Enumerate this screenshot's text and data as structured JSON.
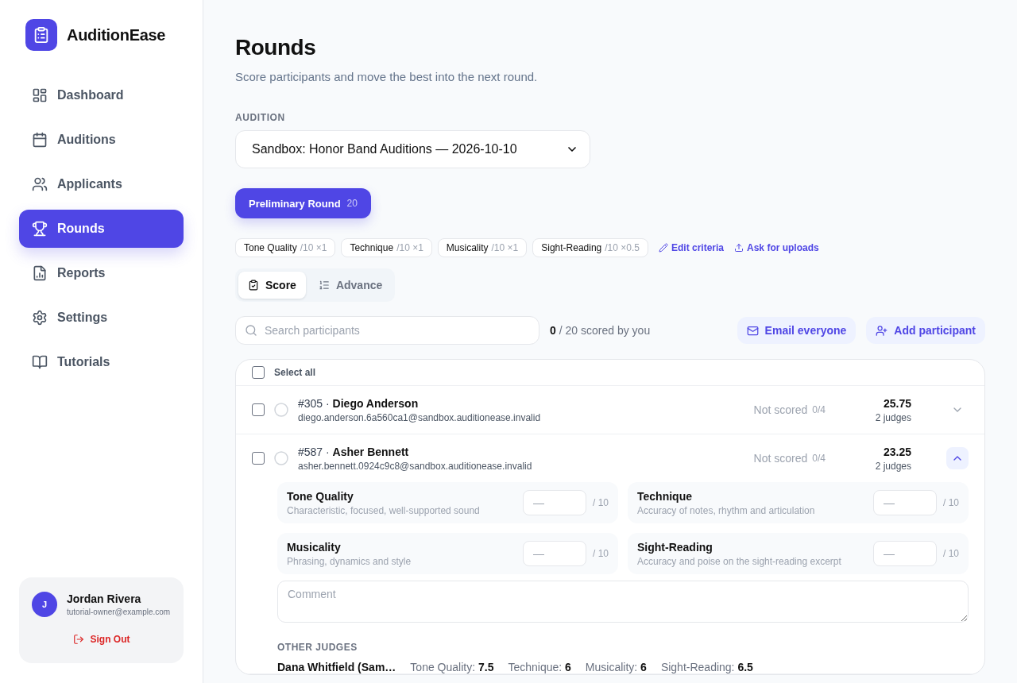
{
  "sidebar": {
    "brand": "AuditionEase",
    "nav": [
      {
        "label": "Dashboard",
        "selected": false
      },
      {
        "label": "Auditions",
        "selected": false
      },
      {
        "label": "Applicants",
        "selected": false
      },
      {
        "label": "Rounds",
        "selected": true
      },
      {
        "label": "Reports",
        "selected": false
      },
      {
        "label": "Settings",
        "selected": false
      },
      {
        "label": "Tutorials",
        "selected": false
      }
    ],
    "user": {
      "initial": "J",
      "name": "Jordan Rivera",
      "email": "tutorial-owner@example.com",
      "sign_out": "Sign Out"
    }
  },
  "header": {
    "title": "Rounds",
    "subtitle": "Score participants and move the best into the next round."
  },
  "audition": {
    "label": "AUDITION",
    "value": "Sandbox: Honor Band Auditions — 2026-10-10"
  },
  "rounds": [
    {
      "label": "Preliminary Round",
      "count": "20",
      "selected": true
    }
  ],
  "criteria": [
    {
      "name": "Tone Quality",
      "detail": "/10 ×1"
    },
    {
      "name": "Technique",
      "detail": "/10 ×1"
    },
    {
      "name": "Musicality",
      "detail": "/10 ×1"
    },
    {
      "name": "Sight-Reading",
      "detail": "/10 ×0.5"
    }
  ],
  "criteria_links": [
    {
      "label": "Edit criteria"
    },
    {
      "label": "Ask for uploads"
    }
  ],
  "tabs": [
    {
      "label": "Score",
      "selected": true
    },
    {
      "label": "Advance",
      "selected": false
    }
  ],
  "search": {
    "placeholder": "Search participants"
  },
  "progress": {
    "scored": "0",
    "label": "/ 20 scored by you"
  },
  "actions": [
    {
      "label": "Email everyone"
    },
    {
      "label": "Add participant"
    }
  ],
  "list": {
    "select_all": {
      "label": "Select all",
      "checked": false
    },
    "participants": [
      {
        "title": "#305 · **Diego Anderson**",
        "email": "diego.anderson.6a560ca1@sandbox.auditionease.invalid",
        "status": "Not scored",
        "status_count": "0/4",
        "total": "25.75",
        "judges": "2 judges",
        "checked": false,
        "expanded": false
      },
      {
        "title": "#587 · **Asher Bennett**",
        "email": "asher.bennett.0924c9c8@sandbox.auditionease.invalid",
        "status": "Not scored",
        "status_count": "0/4",
        "total": "23.25",
        "judges": "2 judges",
        "checked": false,
        "expanded": true,
        "scores": [
          {
            "name": "Tone Quality",
            "description": "Characteristic, focused, well-supported sound",
            "placeholder": "—",
            "max": "/ 10"
          },
          {
            "name": "Technique",
            "description": "Accuracy of notes, rhythm and articulation",
            "placeholder": "—",
            "max": "/ 10"
          },
          {
            "name": "Musicality",
            "description": "Phrasing, dynamics and style",
            "placeholder": "—",
            "max": "/ 10"
          },
          {
            "name": "Sight-Reading",
            "description": "Accuracy and poise on the sight-reading excerpt",
            "placeholder": "—",
            "max": "/ 10"
          }
        ],
        "comment": {
          "placeholder": "Comment"
        },
        "other_judges": {
          "heading": "OTHER JUDGES",
          "judges": [
            {
              "name": "Dana Whitfield (Sam…",
              "scores": [
                "Tone Quality: **7.5**",
                "Technique: **6**",
                "Musicality: **6**",
                "Sight-Reading: **6.5**"
              ]
            }
          ]
        }
      }
    ]
  }
}
